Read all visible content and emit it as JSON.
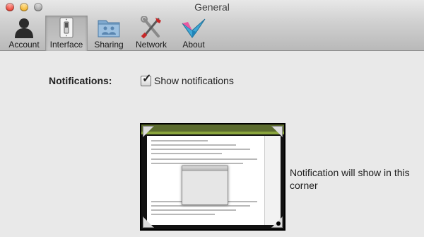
{
  "window": {
    "title": "General"
  },
  "toolbar": {
    "items": [
      {
        "label": "Account",
        "icon": "user-silhouette-icon"
      },
      {
        "label": "Interface",
        "icon": "switch-panel-icon"
      },
      {
        "label": "Sharing",
        "icon": "shared-folder-icon"
      },
      {
        "label": "Network",
        "icon": "tools-icon"
      },
      {
        "label": "About",
        "icon": "paper-crane-icon"
      }
    ],
    "selected": "Interface"
  },
  "notifications": {
    "label": "Notifications:",
    "checkbox_label": "Show notifications",
    "checked": true,
    "corner_text": "Notification will show in this corner"
  },
  "colors": {
    "background": "#e9e9e9",
    "close": "#ea4c3f",
    "minimize": "#f2b637",
    "zoom": "#a6a6a6"
  }
}
